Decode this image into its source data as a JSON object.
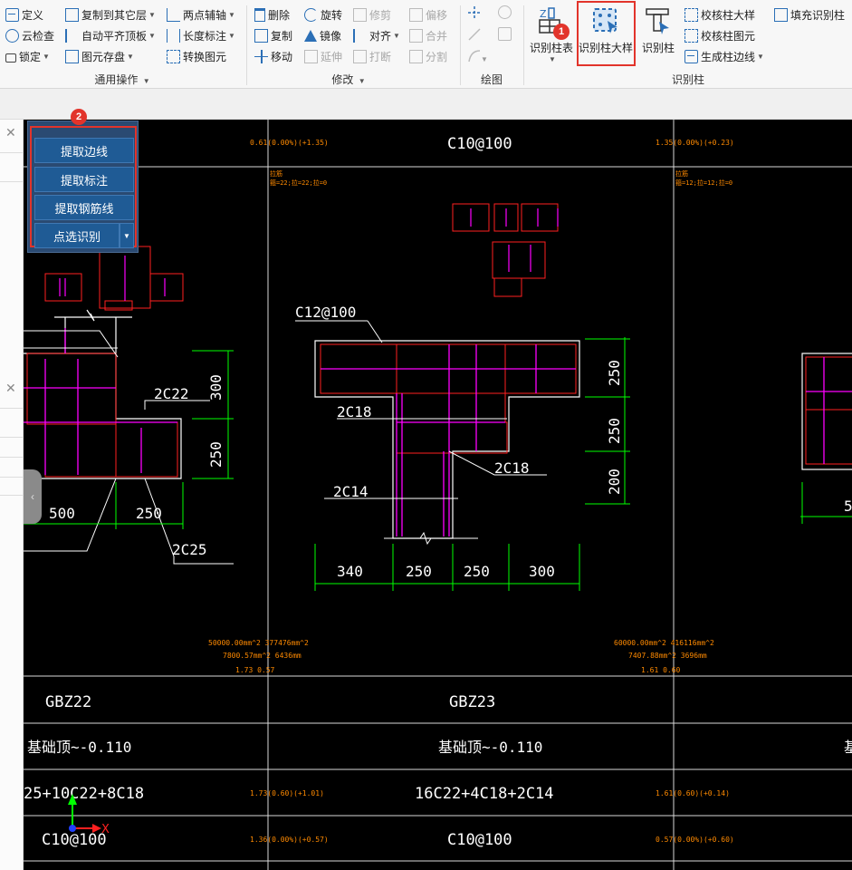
{
  "ribbon": {
    "general": {
      "col1": [
        "定义",
        "云检查",
        "锁定"
      ],
      "col2": [
        "复制到其它层",
        "自动平齐顶板",
        "图元存盘"
      ],
      "col3": [
        "两点辅轴",
        "长度标注",
        "转换图元"
      ],
      "label": "通用操作"
    },
    "modify": {
      "col1": [
        "删除",
        "复制",
        "移动"
      ],
      "col2": [
        "旋转",
        "镜像",
        "延伸"
      ],
      "col3": [
        "修剪",
        "对齐",
        "打断"
      ],
      "col4": [
        "偏移",
        "合并",
        "分割"
      ],
      "label": "修改"
    },
    "draw": {
      "label": "绘图"
    },
    "recognize": {
      "btn_table": "识别柱表",
      "btn_detail": "识别柱大样",
      "btn_column": "识别柱",
      "small1": "校核柱大样",
      "small2": "校核柱图元",
      "small3": "生成柱边线",
      "fill": "填充识别柱",
      "label": "识别柱"
    }
  },
  "popup": {
    "items": [
      "提取边线",
      "提取标注",
      "提取钢筋线",
      "点选识别"
    ]
  },
  "badges": [
    "1",
    "2"
  ],
  "cad": {
    "top_left_text": "0.61(0.00%)(+1.35)",
    "top_mid_text": "C10@100",
    "top_right_text": "1.35(0.00%)(+0.23)",
    "small_ann_mid": [
      "拉筋",
      "箍=22;拉=22;拉=0"
    ],
    "small_ann_right": [
      "拉筋",
      "箍=12;拉=12;拉=0"
    ],
    "mid_label_c12": "C12@100",
    "labels": [
      "2C22",
      "2C18",
      "2C18",
      "2C14",
      "2C25"
    ],
    "dims_left_v": [
      "300",
      "250"
    ],
    "dims_left_h": [
      "500",
      "250"
    ],
    "dims_mid_v": [
      "250",
      "250",
      "200"
    ],
    "dims_mid_h": [
      "340",
      "250",
      "250",
      "300"
    ],
    "dim_right": "5",
    "stats_mid": [
      "50000.00mm^2 377476mm^2",
      "7800.57mm^2 6436mm",
      "1.73 0.57"
    ],
    "stats_right": [
      "60000.00mm^2 416116mm^2",
      "7407.88mm^2 3696mm",
      "1.61 0.60"
    ],
    "table": {
      "row1": [
        "GBZ22",
        "GBZ23"
      ],
      "row2": [
        "基础顶~-0.110",
        "基础顶~-0.110"
      ],
      "row3": [
        "25+10C22+8C18",
        "1.73(0.60)(+1.01)",
        "16C22+4C18+2C14",
        "1.61(0.60)(+0.14)"
      ],
      "row4": [
        "C10@100",
        "1.36(0.00%)(+0.57)",
        "C10@100",
        "0.57(0.00%)(+0.60)"
      ]
    },
    "axis_x": "X"
  },
  "colors": {
    "accent": "#2b6fb6",
    "highlight": "#e2342b",
    "cad_green": "#00ff00",
    "cad_magenta": "#ff00ff",
    "cad_red": "#ff2020",
    "cad_orange": "#ff8a00"
  }
}
